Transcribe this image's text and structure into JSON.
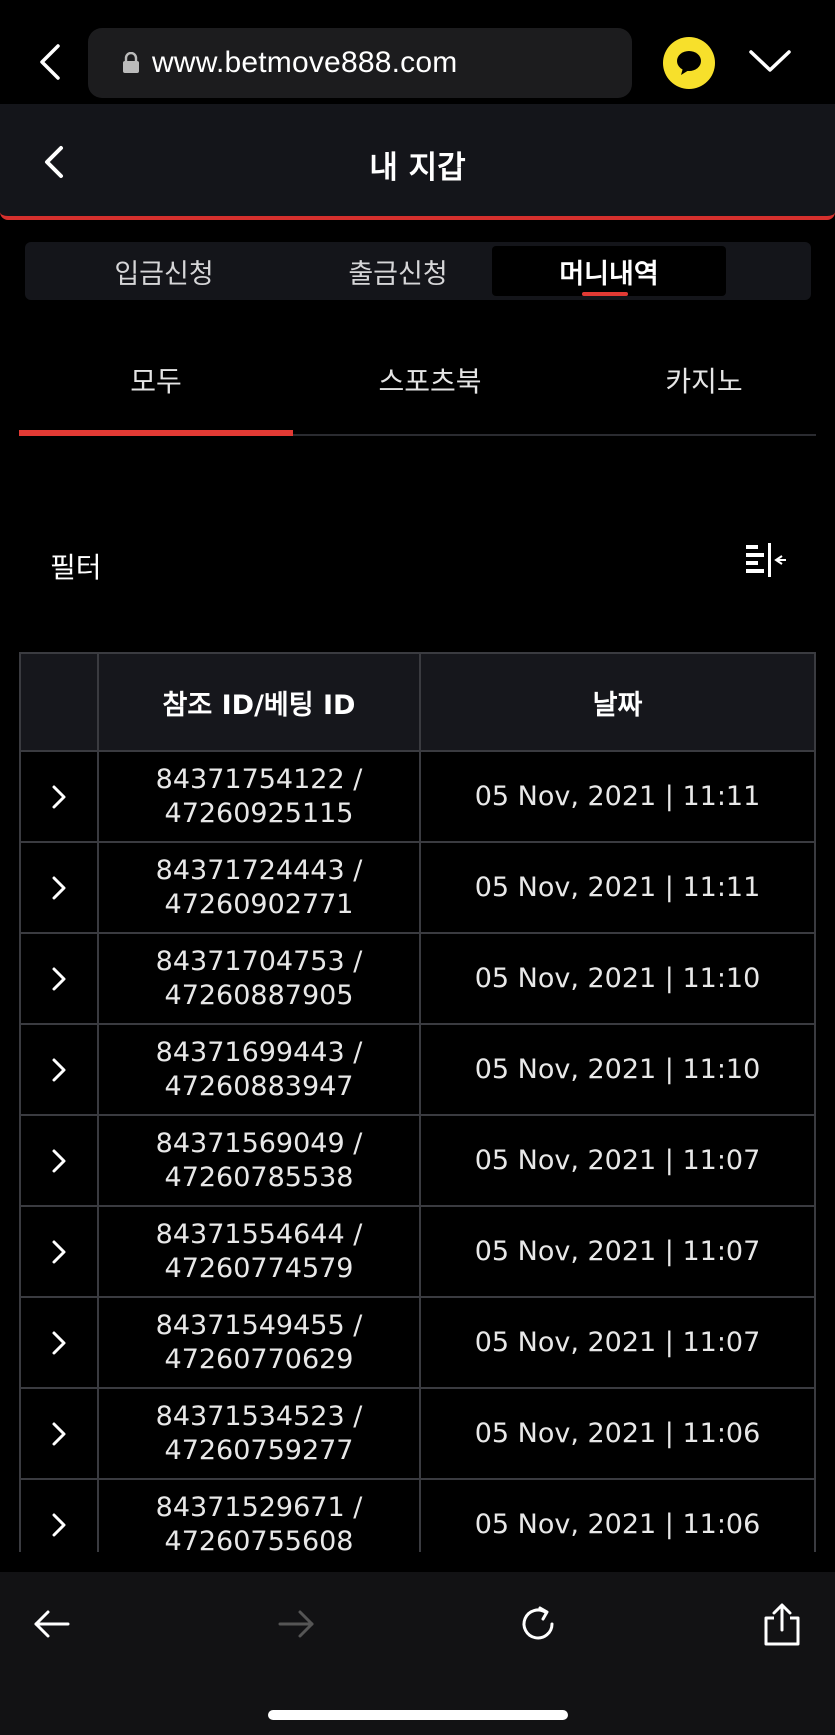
{
  "browser": {
    "url": "www.betmove888.com"
  },
  "header": {
    "title": "내 지갑"
  },
  "segments": [
    "입금신청",
    "출금신청",
    "머니내역"
  ],
  "categories": [
    "모두",
    "스포츠북",
    "카지노"
  ],
  "filter": {
    "label": "필터"
  },
  "table": {
    "headers": [
      "참조 ID/베팅 ID",
      "날짜"
    ],
    "rows": [
      {
        "ref": "84371754122 /",
        "bet": "47260925115",
        "date": "05 Nov, 2021 | 11:11"
      },
      {
        "ref": "84371724443 /",
        "bet": "47260902771",
        "date": "05 Nov, 2021 | 11:11"
      },
      {
        "ref": "84371704753 /",
        "bet": "47260887905",
        "date": "05 Nov, 2021 | 11:10"
      },
      {
        "ref": "84371699443 /",
        "bet": "47260883947",
        "date": "05 Nov, 2021 | 11:10"
      },
      {
        "ref": "84371569049 /",
        "bet": "47260785538",
        "date": "05 Nov, 2021 | 11:07"
      },
      {
        "ref": "84371554644 /",
        "bet": "47260774579",
        "date": "05 Nov, 2021 | 11:07"
      },
      {
        "ref": "84371549455 /",
        "bet": "47260770629",
        "date": "05 Nov, 2021 | 11:07"
      },
      {
        "ref": "84371534523 /",
        "bet": "47260759277",
        "date": "05 Nov, 2021 | 11:06"
      },
      {
        "ref": "84371529671 /",
        "bet": "47260755608",
        "date": "05 Nov, 2021 | 11:06"
      }
    ]
  },
  "colors": {
    "accent": "#e23a34",
    "kakao": "#f7e02b",
    "panel": "#14151a"
  },
  "icons": {
    "browser_back": "chevron-left-icon",
    "lock": "lock-icon",
    "chat": "kakao-chat-icon",
    "menu": "chevron-down-icon",
    "filter": "filter-icon",
    "row": "chevron-right-icon",
    "nav_back": "arrow-left-icon",
    "nav_forward": "arrow-right-icon",
    "reload": "reload-icon",
    "share": "share-icon"
  }
}
